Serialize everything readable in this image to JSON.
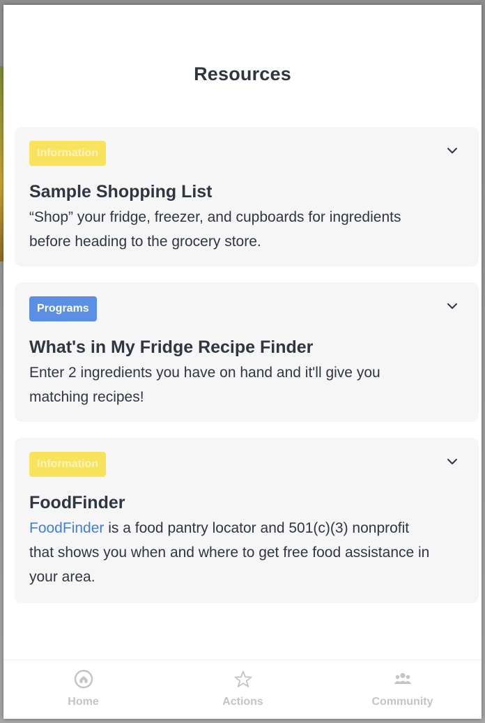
{
  "page": {
    "title": "Resources"
  },
  "resources": [
    {
      "badge": "Information",
      "title": "Sample Shopping List",
      "description": "“Shop” your fridge, freezer, and cupboards for ingredients before heading to the grocery store."
    },
    {
      "badge": "Programs",
      "title": "What's in My Fridge Recipe Finder",
      "description": "Enter 2 ingredients you have on hand and it'll give you matching recipes!"
    },
    {
      "badge": "Information",
      "title": "FoodFinder",
      "link_text": "FoodFinder",
      "description_rest": " is a food pantry locator and 501(c)(3) nonprofit that shows you when and where to get free food assistance in your area."
    }
  ],
  "tabs": [
    {
      "label": "Home",
      "icon": "home-icon"
    },
    {
      "label": "Actions",
      "icon": "star-icon"
    },
    {
      "label": "Community",
      "icon": "people-icon"
    }
  ],
  "colors": {
    "information_badge": "#f7e35c",
    "programs_badge": "#5b8fe6",
    "link": "#3f7fdc",
    "text": "#2f3640",
    "card_bg": "#f6f6f7",
    "tab_inactive": "#c4c4c4"
  }
}
